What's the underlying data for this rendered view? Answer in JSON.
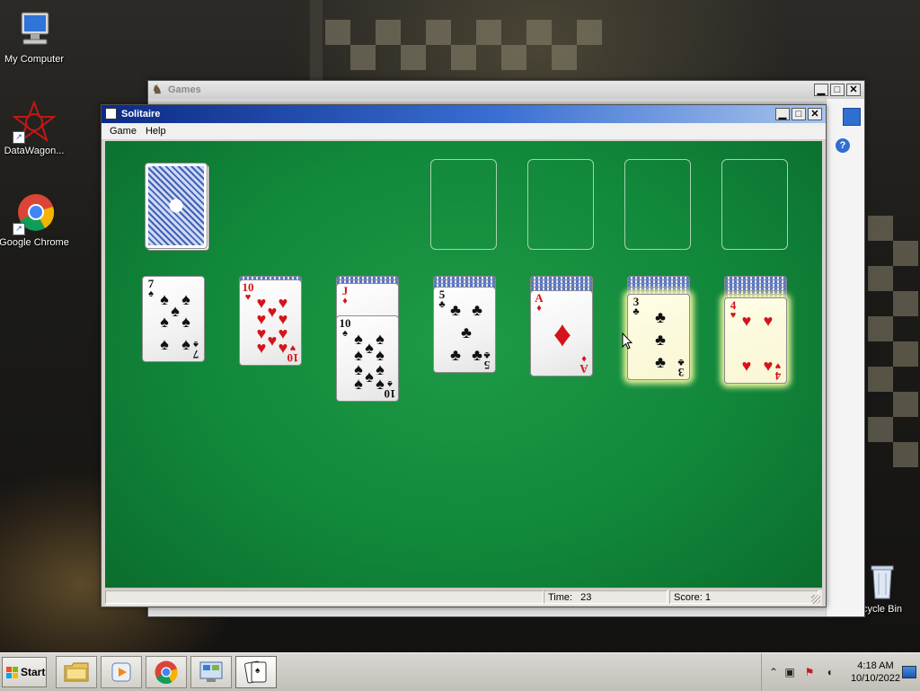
{
  "desktop": {
    "icons": [
      {
        "label": "My Computer"
      },
      {
        "label": "DataWagon..."
      },
      {
        "label": "Google Chrome"
      },
      {
        "label": "cycle Bin"
      }
    ]
  },
  "games_window": {
    "title": "Games"
  },
  "solitaire": {
    "title": "Solitaire",
    "menu": [
      "Game",
      "Help"
    ],
    "status": {
      "time_label": "Time:",
      "time_value": "23",
      "score_label": "Score:",
      "score_value": "1"
    },
    "stock": {
      "face_down": true
    },
    "foundations": [
      {
        "empty": true
      },
      {
        "empty": true
      },
      {
        "empty": true
      },
      {
        "empty": true
      }
    ],
    "tableau": [
      {
        "hidden_count": 0,
        "face_up": [
          {
            "rank": "7",
            "suit": "spades"
          }
        ]
      },
      {
        "hidden_count": 1,
        "face_up": [
          {
            "rank": "10",
            "suit": "hearts"
          }
        ]
      },
      {
        "hidden_count": 2,
        "face_up": [
          {
            "rank": "J",
            "suit": "diamonds"
          },
          {
            "rank": "10",
            "suit": "spades"
          }
        ]
      },
      {
        "hidden_count": 3,
        "face_up": [
          {
            "rank": "5",
            "suit": "clubs"
          }
        ]
      },
      {
        "hidden_count": 4,
        "face_up": [
          {
            "rank": "A",
            "suit": "diamonds"
          }
        ]
      },
      {
        "hidden_count": 5,
        "face_up": [
          {
            "rank": "3",
            "suit": "clubs",
            "highlighted": true
          }
        ]
      },
      {
        "hidden_count": 6,
        "face_up": [
          {
            "rank": "4",
            "suit": "hearts",
            "highlighted": true
          }
        ]
      }
    ]
  },
  "taskbar": {
    "start_label": "Start",
    "buttons": [
      "windows-explorer-icon",
      "media-player-icon",
      "chrome-icon",
      "control-panel-icon",
      "solitaire-icon"
    ],
    "clock": {
      "time": "4:18 AM",
      "date": "10/10/2022"
    }
  },
  "colors": {
    "felt": "#11873a",
    "title_active": "#0c2a86",
    "card_red": "#d4141a",
    "highlight": "#f3f7a0"
  }
}
